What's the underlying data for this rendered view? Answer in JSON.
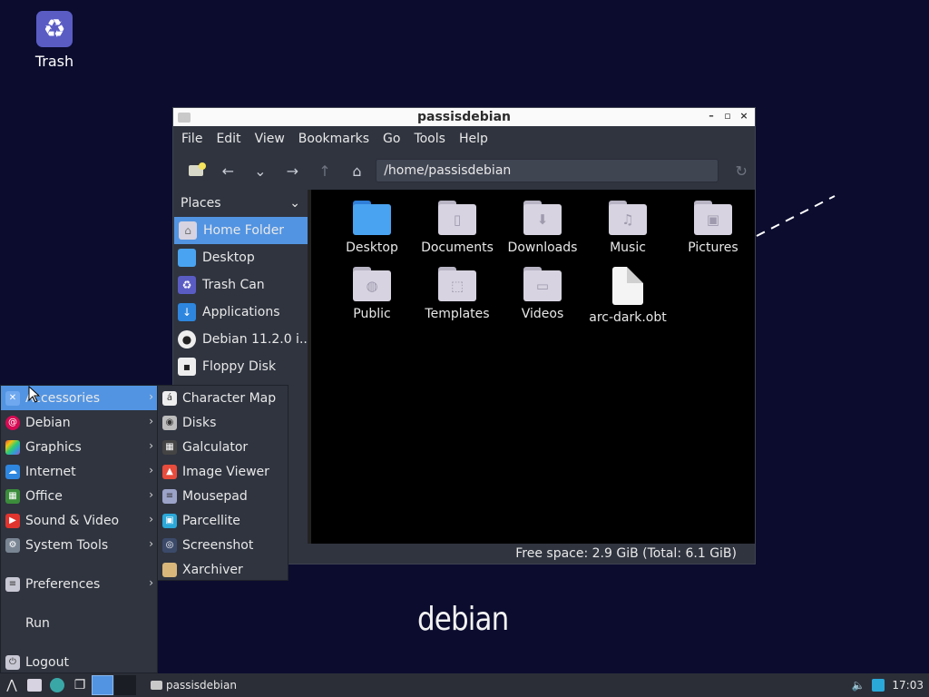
{
  "desktop": {
    "trash_label": "Trash",
    "logo_text": "debian"
  },
  "window": {
    "title": "passisdebian",
    "controls": {
      "minimize": "–",
      "maximize": "▫",
      "close": "×"
    },
    "menubar": [
      "File",
      "Edit",
      "View",
      "Bookmarks",
      "Go",
      "Tools",
      "Help"
    ],
    "path": "/home/passisdebian",
    "sidebar": {
      "header": "Places",
      "items": [
        {
          "label": "Home Folder",
          "icon": "home-icon",
          "selected": true
        },
        {
          "label": "Desktop",
          "icon": "desktop-icon"
        },
        {
          "label": "Trash Can",
          "icon": "trash-icon"
        },
        {
          "label": "Applications",
          "icon": "applications-icon"
        },
        {
          "label": "Debian 11.2.0 i...",
          "icon": "disc-icon"
        },
        {
          "label": "Floppy Disk",
          "icon": "floppy-icon"
        }
      ]
    },
    "files": [
      {
        "label": "Desktop",
        "icon": "desktop-folder-icon"
      },
      {
        "label": "Documents",
        "icon": "documents-folder-icon"
      },
      {
        "label": "Downloads",
        "icon": "downloads-folder-icon"
      },
      {
        "label": "Music",
        "icon": "music-folder-icon"
      },
      {
        "label": "Pictures",
        "icon": "pictures-folder-icon"
      },
      {
        "label": "Public",
        "icon": "public-folder-icon"
      },
      {
        "label": "Templates",
        "icon": "templates-folder-icon"
      },
      {
        "label": "Videos",
        "icon": "videos-folder-icon"
      },
      {
        "label": "arc-dark.obt",
        "icon": "file-icon"
      }
    ],
    "status": "Free space: 2.9 GiB (Total: 6.1 GiB)"
  },
  "app_menu": {
    "items": [
      {
        "label": "Accessories",
        "color": "#5294e2"
      },
      {
        "label": "Debian",
        "color": "#d70a53"
      },
      {
        "label": "Graphics",
        "color": "#9b59b6"
      },
      {
        "label": "Internet",
        "color": "#2e86de"
      },
      {
        "label": "Office",
        "color": "#3b8c3b"
      },
      {
        "label": "Sound & Video",
        "color": "#e0342f"
      },
      {
        "label": "System Tools",
        "color": "#7a8593"
      }
    ],
    "preferences": "Preferences",
    "run": "Run",
    "logout": "Logout"
  },
  "submenu": {
    "items": [
      {
        "label": "Character Map",
        "icon": "charmap-icon"
      },
      {
        "label": "Disks",
        "icon": "disks-icon"
      },
      {
        "label": "Galculator",
        "icon": "calculator-icon"
      },
      {
        "label": "Image Viewer",
        "icon": "image-viewer-icon"
      },
      {
        "label": "Mousepad",
        "icon": "text-editor-icon"
      },
      {
        "label": "Parcellite",
        "icon": "clipboard-icon"
      },
      {
        "label": "Screenshot",
        "icon": "camera-icon"
      },
      {
        "label": "Xarchiver",
        "icon": "archive-icon"
      }
    ]
  },
  "taskbar": {
    "task_label": "passisdebian",
    "clock": "17:03"
  },
  "colors": {
    "accent": "#5294e2",
    "panel": "#2f343f",
    "desktop": "#0b0c2e"
  }
}
